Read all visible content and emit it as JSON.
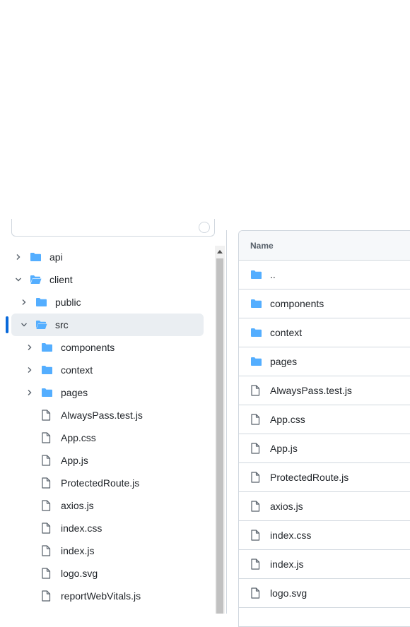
{
  "colors": {
    "folder": "#54aeff",
    "file": "#57606a",
    "selected_bg": "#eaeef2",
    "active_bar": "#0969da",
    "border": "#d0d7de"
  },
  "tree": {
    "items": [
      {
        "label": "api",
        "type": "folder",
        "level": 0,
        "expanded": false
      },
      {
        "label": "client",
        "type": "folder-open",
        "level": 0,
        "expanded": true
      },
      {
        "label": "public",
        "type": "folder",
        "level": 1,
        "expanded": false
      },
      {
        "label": "src",
        "type": "folder-open",
        "level": 1,
        "expanded": true,
        "selected": true
      },
      {
        "label": "components",
        "type": "folder",
        "level": 2,
        "expanded": false
      },
      {
        "label": "context",
        "type": "folder",
        "level": 2,
        "expanded": false
      },
      {
        "label": "pages",
        "type": "folder",
        "level": 2,
        "expanded": false
      },
      {
        "label": "AlwaysPass.test.js",
        "type": "file",
        "level": 2
      },
      {
        "label": "App.css",
        "type": "file",
        "level": 2
      },
      {
        "label": "App.js",
        "type": "file",
        "level": 2
      },
      {
        "label": "ProtectedRoute.js",
        "type": "file",
        "level": 2
      },
      {
        "label": "axios.js",
        "type": "file",
        "level": 2
      },
      {
        "label": "index.css",
        "type": "file",
        "level": 2
      },
      {
        "label": "index.js",
        "type": "file",
        "level": 2
      },
      {
        "label": "logo.svg",
        "type": "file",
        "level": 2
      },
      {
        "label": "reportWebVitals.js",
        "type": "file",
        "level": 2
      }
    ]
  },
  "listing": {
    "header": "Name",
    "rows": [
      {
        "label": "..",
        "type": "folder"
      },
      {
        "label": "components",
        "type": "folder"
      },
      {
        "label": "context",
        "type": "folder"
      },
      {
        "label": "pages",
        "type": "folder"
      },
      {
        "label": "AlwaysPass.test.js",
        "type": "file"
      },
      {
        "label": "App.css",
        "type": "file"
      },
      {
        "label": "App.js",
        "type": "file"
      },
      {
        "label": "ProtectedRoute.js",
        "type": "file"
      },
      {
        "label": "axios.js",
        "type": "file"
      },
      {
        "label": "index.css",
        "type": "file"
      },
      {
        "label": "index.js",
        "type": "file"
      },
      {
        "label": "logo.svg",
        "type": "file"
      }
    ]
  }
}
